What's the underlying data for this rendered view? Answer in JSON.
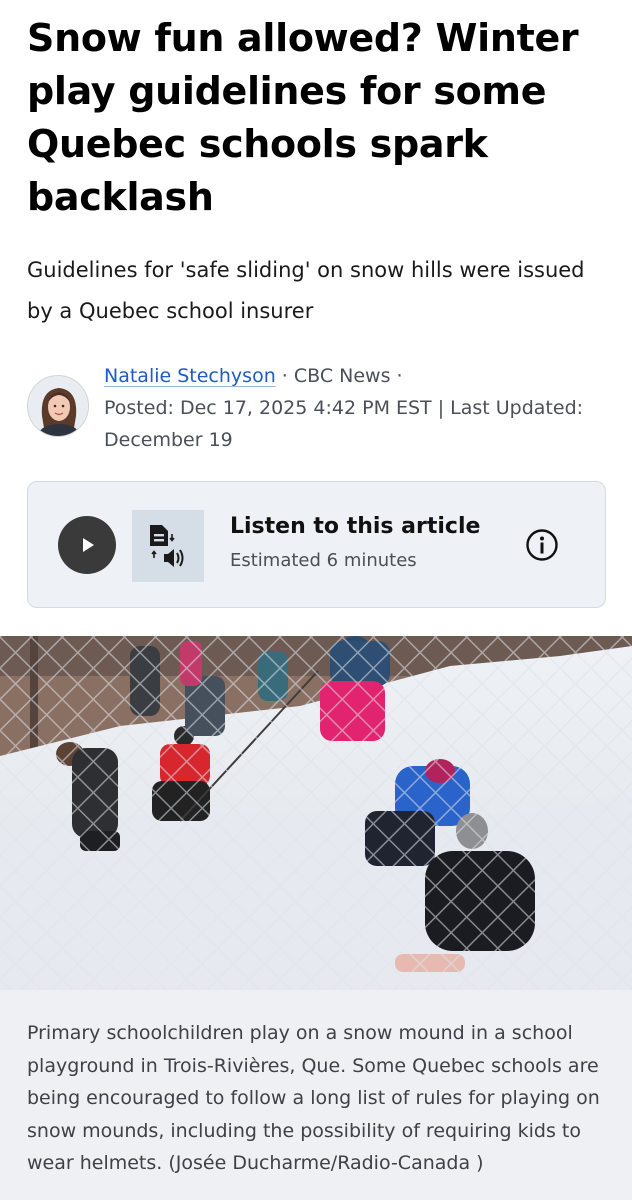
{
  "article": {
    "headline": "Snow fun allowed? Winter play guidelines for some Quebec schools spark backlash",
    "deck": "Guidelines for 'safe sliding' on snow hills were issued by a Quebec school insurer"
  },
  "byline": {
    "author": "Natalie Stechyson",
    "separator1": " · ",
    "outlet": "CBC News",
    "separator2": " · ",
    "posted": "Posted: Dec 17, 2025 4:42 PM EST | Last Updated: December 19"
  },
  "audio": {
    "title": "Listen to this article",
    "subtitle": "Estimated 6 minutes",
    "play_icon": "play-icon",
    "tts_icon": "text-to-speech-icon",
    "info_icon": "info-icon"
  },
  "photo": {
    "caption": "Primary schoolchildren play on a snow mound in a school playground in Trois-Rivières, Que. Some Quebec schools are being encouraged to follow a long list of rules for playing on snow mounds, including the possibility of requiring kids to wear helmets. (Josée Ducharme/Radio-Canada )"
  },
  "colors": {
    "link": "#1f5bc4",
    "card_bg": "#eef2f6",
    "caption_bg": "#eef0f3"
  }
}
